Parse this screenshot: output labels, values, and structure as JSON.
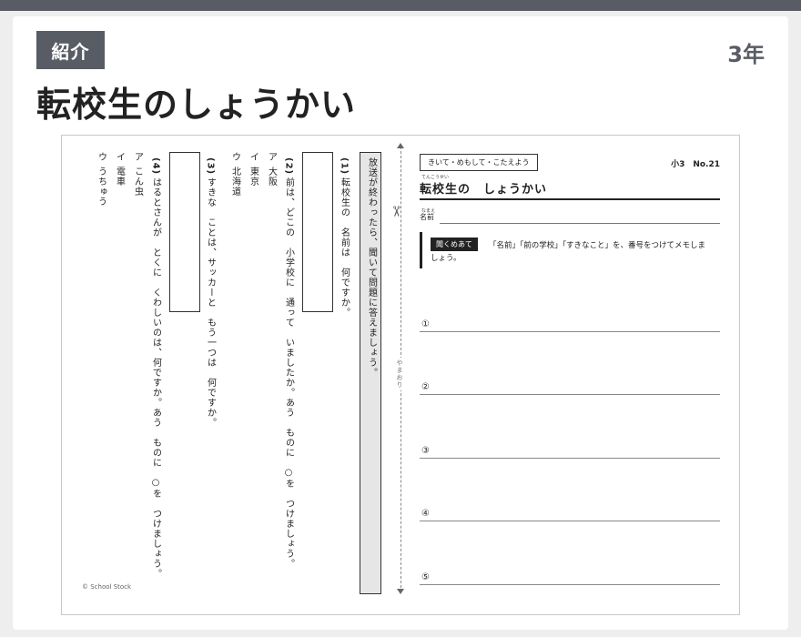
{
  "header": {
    "badge": "紹介",
    "grade": "3年",
    "title": "転校生のしょうかい"
  },
  "left_page": {
    "instruction": "放送が終わったら、聞いて問題に答えましょう。",
    "q1": {
      "num": "(1)",
      "text": "転校生の　名前は　何ですか。"
    },
    "q2": {
      "num": "(2)",
      "text": "前は、どこの　小学校に　通って　いましたか。あう　ものに　○を　つけましょう。",
      "options": [
        {
          "mark": "ア",
          "text": "大阪"
        },
        {
          "mark": "イ",
          "text": "東京"
        },
        {
          "mark": "ウ",
          "text": "北海道"
        }
      ]
    },
    "q3": {
      "num": "(3)",
      "text": "すきな　ことは、サッカーと　もう一つは　何ですか。"
    },
    "q4": {
      "num": "(4)",
      "text": "はるとさんが　とくに　くわしいのは、何ですか。あう　ものに　○を　つけましょう。",
      "options": [
        {
          "mark": "ア",
          "text": "こん虫"
        },
        {
          "mark": "イ",
          "text": "電車"
        },
        {
          "mark": "ウ",
          "text": "うちゅう"
        }
      ]
    },
    "fold_label": "やまおり",
    "copyright": "© School Stock"
  },
  "right_page": {
    "tag": "きいて・めもして・こたえよう",
    "number": "小3　No.21",
    "title_ruby": "てんこうせい",
    "title": "転校生の　しょうかい",
    "name_ruby": "なまえ",
    "name_label": "名前",
    "listen_label": "聞くめあて",
    "instruction_line1": "「名前」「前の学校」「すきなこと」を、番号をつけてメモしま",
    "instruction_line2": "しょう。",
    "answers": [
      "①",
      "②",
      "③",
      "④",
      "⑤"
    ]
  }
}
